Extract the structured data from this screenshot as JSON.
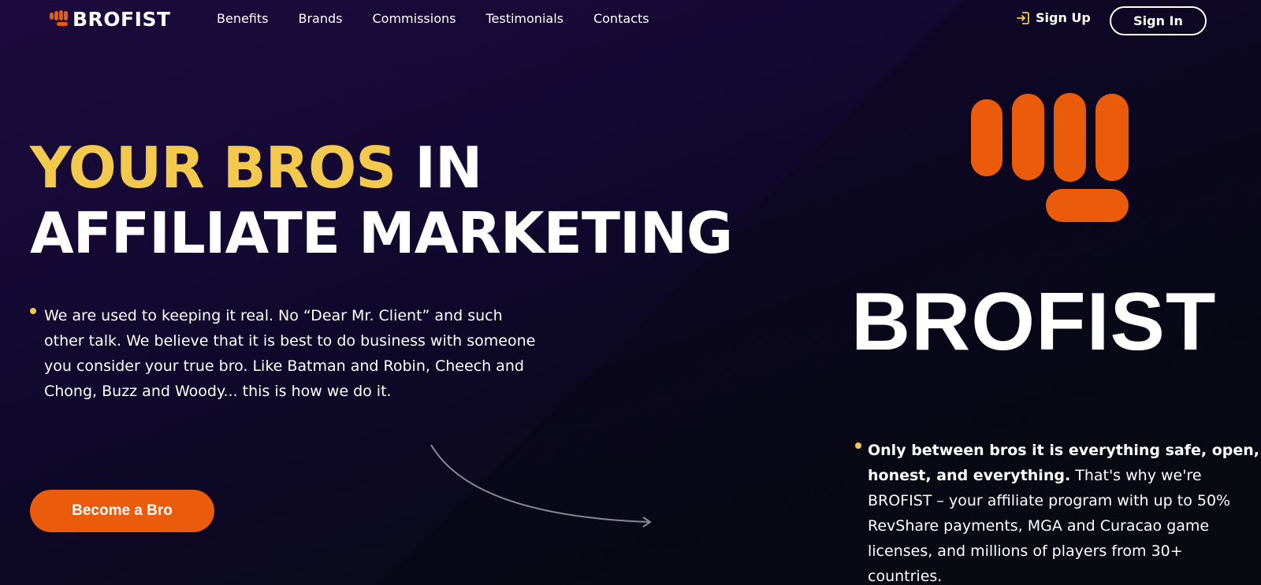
{
  "header": {
    "logo_text": "BROFIST",
    "nav": [
      "Benefits",
      "Brands",
      "Commissions",
      "Testimonials",
      "Contacts"
    ],
    "signup_label": "Sign Up",
    "signin_label": "Sign In"
  },
  "hero": {
    "headline_yellow": "YOUR BROS",
    "headline_white_1": "IN",
    "headline_white_2": "AFFILIATE MARKETING",
    "intro_line_1": "We are used to keeping it real. No “Dear Mr. Client” and such",
    "intro_line_2": "other talk. We believe that it is best to do business with someone",
    "intro_line_3": "you consider your true bro. Like Batman and Robin, Cheech and",
    "intro_line_4": "Chong, Buzz and Woody... this is how we do it.",
    "cta_label": "Become a Bro"
  },
  "brand_panel": {
    "wordmark": "BROFIST",
    "bold_line_1": "Only between bros it is everything safe, open,",
    "bold_line_2": "honest, and everything.",
    "text_line_2_rest": " That's why we're",
    "text_line_3": "BROFIST – your affiliate program with up to 50%",
    "text_line_4": "RevShare payments, MGA and Curacao game",
    "text_line_5": "licenses, and millions of players from 30+",
    "text_line_6": "countries."
  },
  "colors": {
    "accent_orange": "#ea5b0c",
    "accent_yellow": "#f2c94c",
    "background": "#140933"
  },
  "icons": {
    "logo": "fist-icon",
    "signup": "login-arrow-icon",
    "arrow": "curved-arrow-icon"
  }
}
